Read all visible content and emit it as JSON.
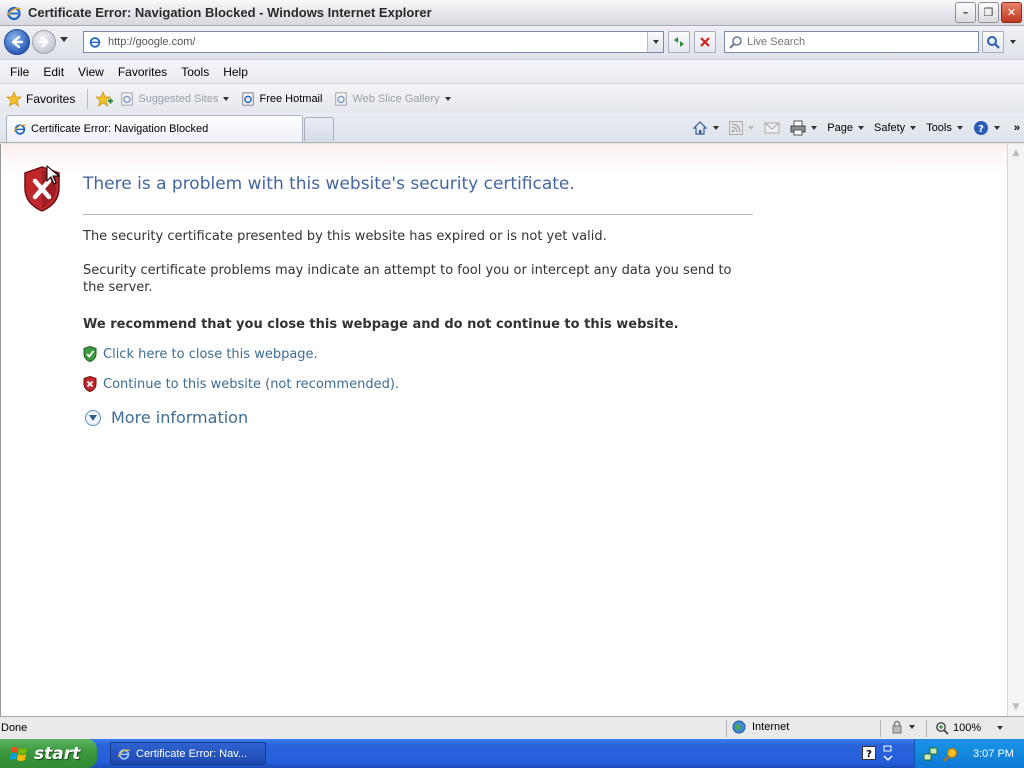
{
  "window": {
    "title": "Certificate Error: Navigation Blocked - Windows Internet Explorer",
    "minimize": "–",
    "restore": "❐",
    "close": "✕"
  },
  "address": {
    "url": "http://google.com/",
    "search_placeholder": "Live Search"
  },
  "menu": {
    "file": "File",
    "edit": "Edit",
    "view": "View",
    "favorites": "Favorites",
    "tools": "Tools",
    "help": "Help"
  },
  "favorites_bar": {
    "favorites_label": "Favorites",
    "links": [
      {
        "label": "Suggested Sites",
        "dim": true,
        "dropdown": true
      },
      {
        "label": "Free Hotmail",
        "dim": false,
        "dropdown": false
      },
      {
        "label": "Web Slice Gallery",
        "dim": true,
        "dropdown": true
      }
    ]
  },
  "tabs": {
    "active_tab_label": "Certificate Error: Navigation Blocked"
  },
  "command_bar": {
    "page": "Page",
    "safety": "Safety",
    "tools": "Tools",
    "more": "»"
  },
  "content": {
    "title": "There is a problem with this website's security certificate.",
    "para1": "The security certificate presented by this website has expired or is not yet valid.",
    "para2": "Security certificate problems may indicate an attempt to fool you or intercept any data you send to the server.",
    "recommendation": "We recommend that you close this webpage and do not continue to this website.",
    "close_link": "Click here to close this webpage.",
    "continue_link": "Continue to this website (not recommended).",
    "more_info": "More information"
  },
  "status_bar": {
    "status": "Done",
    "zone": "Internet",
    "zoom": "100%"
  },
  "taskbar": {
    "start": "start",
    "task_item": "Certificate Error: Nav...",
    "clock": "3:07 PM"
  },
  "colors": {
    "title_blue": "#4465a2",
    "link_blue": "#3e6c93",
    "error_red": "#c0272d",
    "safe_green": "#3b9a3f"
  },
  "icons": {
    "app": "ie-icon",
    "error_shield": "error-shield-icon",
    "safe_shield": "green-shield-icon",
    "expand": "expand-circle-icon"
  }
}
